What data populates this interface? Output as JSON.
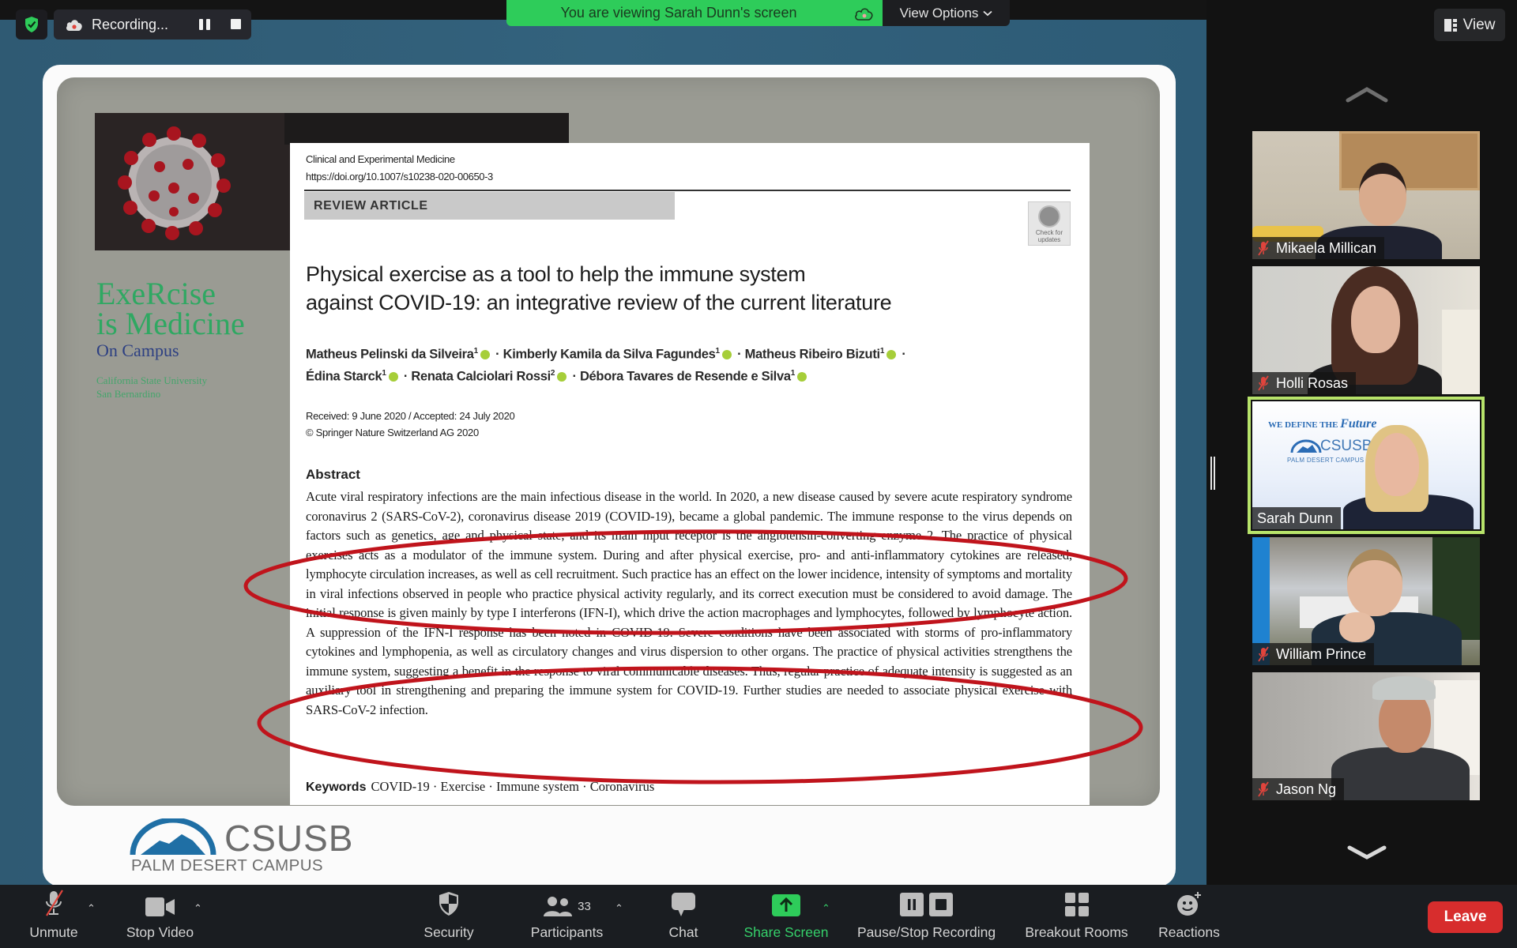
{
  "top_bar": {
    "recording_label": "Recording...",
    "viewing_banner": "You are viewing Sarah Dunn's screen",
    "view_options_label": "View Options",
    "view_button_label": "View"
  },
  "shared_slide": {
    "program_logo": {
      "line1": "ExeRcise",
      "line2": "is Medicine",
      "sub": "On Campus",
      "university_line1": "California State University",
      "university_line2": "San Bernardino"
    },
    "paper": {
      "journal": "Clinical and Experimental Medicine",
      "doi": "https://doi.org/10.1007/s10238-020-00650-3",
      "article_type": "REVIEW ARTICLE",
      "check_updates_line1": "Check for",
      "check_updates_line2": "updates",
      "title_line1": "Physical exercise as a tool to help the immune system",
      "title_line2": "against COVID-19: an integrative review of the current literature",
      "authors": [
        {
          "name": "Matheus Pelinski da Silveira",
          "aff": "1"
        },
        {
          "name": "Kimberly Kamila da Silva Fagundes",
          "aff": "1"
        },
        {
          "name": "Matheus Ribeiro Bizuti",
          "aff": "1"
        },
        {
          "name": "Édina Starck",
          "aff": "1"
        },
        {
          "name": "Renata Calciolari Rossi",
          "aff": "2"
        },
        {
          "name": "Débora Tavares de Resende e Silva",
          "aff": "1"
        }
      ],
      "received": "Received: 9 June 2020 / Accepted: 24 July 2020",
      "copyright": "© Springer Nature Switzerland AG 2020",
      "abstract_heading": "Abstract",
      "abstract_text": "Acute viral respiratory infections are the main infectious disease in the world. In 2020, a new disease caused by severe acute respiratory syndrome coronavirus 2 (SARS-CoV-2), coronavirus disease 2019 (COVID-19), became a global pandemic. The immune response to the virus depends on factors such as genetics, age and physical state, and its main input receptor is the angiotensin-converting enzyme 2. The practice of physical exercises acts as a modulator of the immune system. During and after physical exercise, pro- and anti-inflammatory cytokines are released, lymphocyte circulation increases, as well as cell recruitment. Such practice has an effect on the lower incidence, intensity of symptoms and mortality in viral infections observed in people who practice physical activity regularly, and its correct execution must be considered to avoid damage. The initial response is given mainly by type I interferons (IFN-I), which drive the action macrophages and lymphocytes, followed by lymphocyte action. A suppression of the IFN-I response has been noted in COVID-19. Severe conditions have been associated with storms of pro-inflammatory cytokines and lymphopenia, as well as circulatory changes and virus dispersion to other organs. The practice of physical activities strengthens the immune system, suggesting a benefit in the response to viral communicable diseases. Thus, regular practice of adequate intensity is suggested as an auxiliary tool in strengthening and preparing the immune system for COVID-19. Further studies are needed to associate physical exercise with SARS-CoV-2 infection.",
      "keywords_label": "Keywords",
      "keywords": "COVID-19 · Exercise · Immune system · Coronavirus"
    },
    "footer_logo": {
      "name": "CSUSB",
      "campus": "PALM DESERT CAMPUS"
    },
    "annotation_color": "#c0141c"
  },
  "participants": [
    {
      "name": "Mikaela Millican",
      "muted": true,
      "active_speaker": false
    },
    {
      "name": "Holli Rosas",
      "muted": true,
      "active_speaker": false
    },
    {
      "name": "Sarah Dunn",
      "muted": false,
      "active_speaker": true,
      "background_text_1": "WE DEFINE THE",
      "background_text_2": "Future",
      "background_logo": "CSUSB",
      "background_campus": "PALM DESERT CAMPUS"
    },
    {
      "name": "William Prince",
      "muted": true,
      "active_speaker": false
    },
    {
      "name": "Jason Ng",
      "muted": true,
      "active_speaker": false
    }
  ],
  "toolbar": {
    "unmute": "Unmute",
    "stop_video": "Stop Video",
    "security": "Security",
    "participants": "Participants",
    "participant_count": "33",
    "chat": "Chat",
    "share_screen": "Share Screen",
    "pause_stop_recording": "Pause/Stop Recording",
    "breakout_rooms": "Breakout Rooms",
    "reactions": "Reactions",
    "leave": "Leave"
  },
  "colors": {
    "banner_green": "#2ecc5a",
    "share_green": "#2ecc5a",
    "leave_red": "#d72d2d",
    "active_speaker_border": "#b7e36a",
    "muted_red": "#e0443c"
  }
}
